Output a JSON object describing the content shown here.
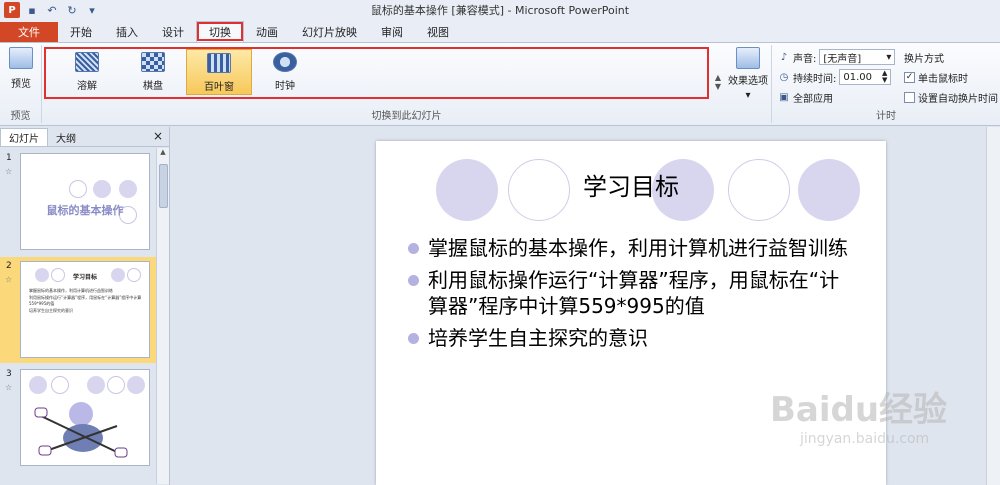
{
  "titlebar": {
    "app_letter": "P",
    "title": "鼠标的基本操作 [兼容模式] - Microsoft PowerPoint"
  },
  "tabs": [
    "文件",
    "开始",
    "插入",
    "设计",
    "切换",
    "动画",
    "幻灯片放映",
    "审阅",
    "视图"
  ],
  "active_tab": "切换",
  "ribbon": {
    "preview_label": "预览",
    "preview_group": "预览",
    "transitions": [
      {
        "label": "溶解",
        "icon": "dissolve-icon"
      },
      {
        "label": "棋盘",
        "icon": "checkerboard-icon"
      },
      {
        "label": "百叶窗",
        "icon": "blinds-icon"
      },
      {
        "label": "时钟",
        "icon": "clock-icon"
      }
    ],
    "selected_transition": "百叶窗",
    "gallery_group": "切换到此幻灯片",
    "effect_options": "效果选项",
    "timing": {
      "sound_label": "声音:",
      "sound_value": "[无声音]",
      "duration_label": "持续时间:",
      "duration_value": "01.00",
      "apply_all": "全部应用",
      "advance_title": "换片方式",
      "on_click_label": "单击鼠标时",
      "on_click_checked": true,
      "auto_label": "设置自动换片时间",
      "auto_checked": false,
      "group": "计时"
    }
  },
  "left_panel": {
    "tab_slides": "幻灯片",
    "tab_outline": "大纲",
    "close": "×",
    "slides": [
      {
        "num": "1",
        "title": "鼠标的基本操作"
      },
      {
        "num": "2",
        "title": "学习目标",
        "lines": [
          "掌握鼠标的基本操作，利用计算机进行益智训练",
          "利用鼠标操作运行“计算器”程序，用鼠标在“计算器”程序中计算559*995的值",
          "培养学生自主探究的意识"
        ]
      },
      {
        "num": "3"
      }
    ]
  },
  "slide": {
    "title": "学习目标",
    "bullets": [
      "掌握鼠标的基本操作，利用计算机进行益智训练",
      "利用鼠标操作运行“计算器”程序，用鼠标在“计算器”程序中计算559*995的值",
      "培养学生自主探究的意识"
    ]
  },
  "watermark": {
    "brand": "Baidu经验",
    "url": "jingyan.baidu.com"
  },
  "colors": {
    "accent_red": "#e03030",
    "file_tab": "#d24726",
    "selected": "#f7c85b",
    "bullet": "#b3b2e0"
  }
}
